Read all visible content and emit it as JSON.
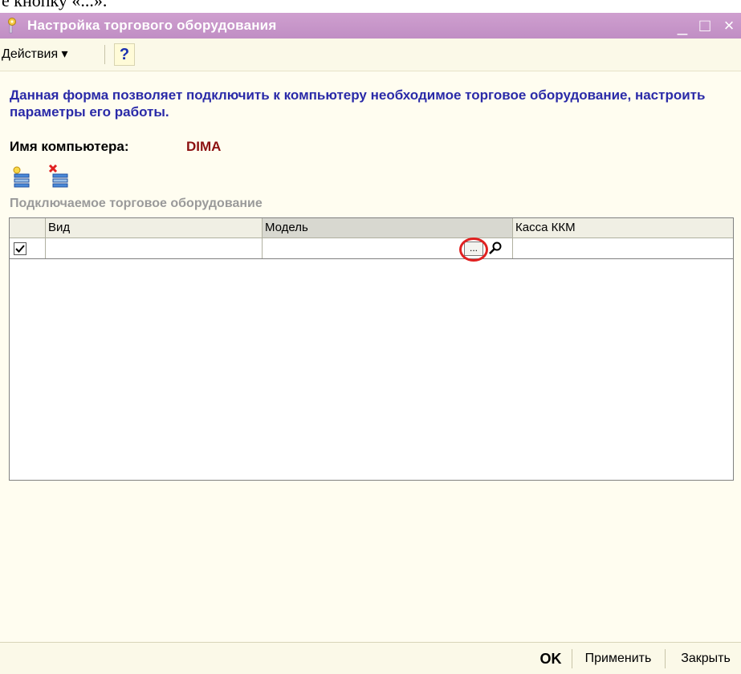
{
  "instruction_fragment": "е кнопку «...».",
  "window": {
    "title": "Настройка торгового оборудования",
    "minimize": "_",
    "maximize": "□",
    "close": "×"
  },
  "toolbar": {
    "actions_label": "Действия ▾",
    "help_label": "?"
  },
  "description": "Данная форма позволяет подключить к компьютеру необходимое торговое оборудование, настроить параметры его работы.",
  "computer": {
    "label": "Имя компьютера:",
    "value": "DIMA"
  },
  "icons": {
    "add": "add-row-icon",
    "delete": "delete-row-icon",
    "search": "search-icon"
  },
  "equipment": {
    "section_label": "Подключаемое торговое оборудование",
    "columns": [
      "Вид",
      "Модель",
      "Касса ККМ"
    ],
    "rows": [
      {
        "checked": true,
        "vid": "",
        "model": "",
        "kassa": ""
      }
    ],
    "ellipsis_label": "..."
  },
  "buttons": {
    "ok": "OK",
    "apply": "Применить",
    "close": "Закрыть"
  },
  "colors": {
    "titlebar": "#c890c8",
    "description": "#2a2aa8",
    "computer_value": "#8b1010",
    "highlight": "#e02020"
  }
}
